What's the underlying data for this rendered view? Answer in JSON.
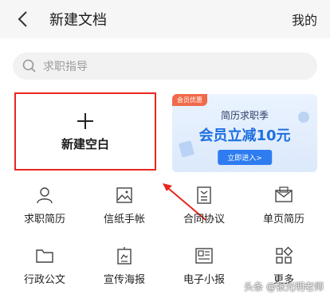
{
  "header": {
    "title": "新建文档",
    "mine_label": "我的"
  },
  "search": {
    "placeholder": "求职指导"
  },
  "new_blank": {
    "label": "新建空白"
  },
  "banner": {
    "tag": "会员优惠",
    "line1": "简历求职季",
    "line2": "会员立减10元",
    "cta": "立即进入>"
  },
  "grid": {
    "items": [
      {
        "label": "求职简历",
        "icon": "person-icon"
      },
      {
        "label": "信纸手帐",
        "icon": "image-icon"
      },
      {
        "label": "合同协议",
        "icon": "contract-icon"
      },
      {
        "label": "单页简历",
        "icon": "envelope-icon"
      },
      {
        "label": "行政公文",
        "icon": "folder-icon"
      },
      {
        "label": "宣传海报",
        "icon": "poster-icon"
      },
      {
        "label": "电子小报",
        "icon": "newspaper-icon"
      },
      {
        "label": "更多",
        "icon": "more-grid-icon"
      }
    ]
  },
  "watermark": "头条 @张光明老师",
  "colors": {
    "highlight_border": "#e8261e",
    "accent_blue": "#1f6fe0",
    "search_bg": "#f2f2f2"
  }
}
